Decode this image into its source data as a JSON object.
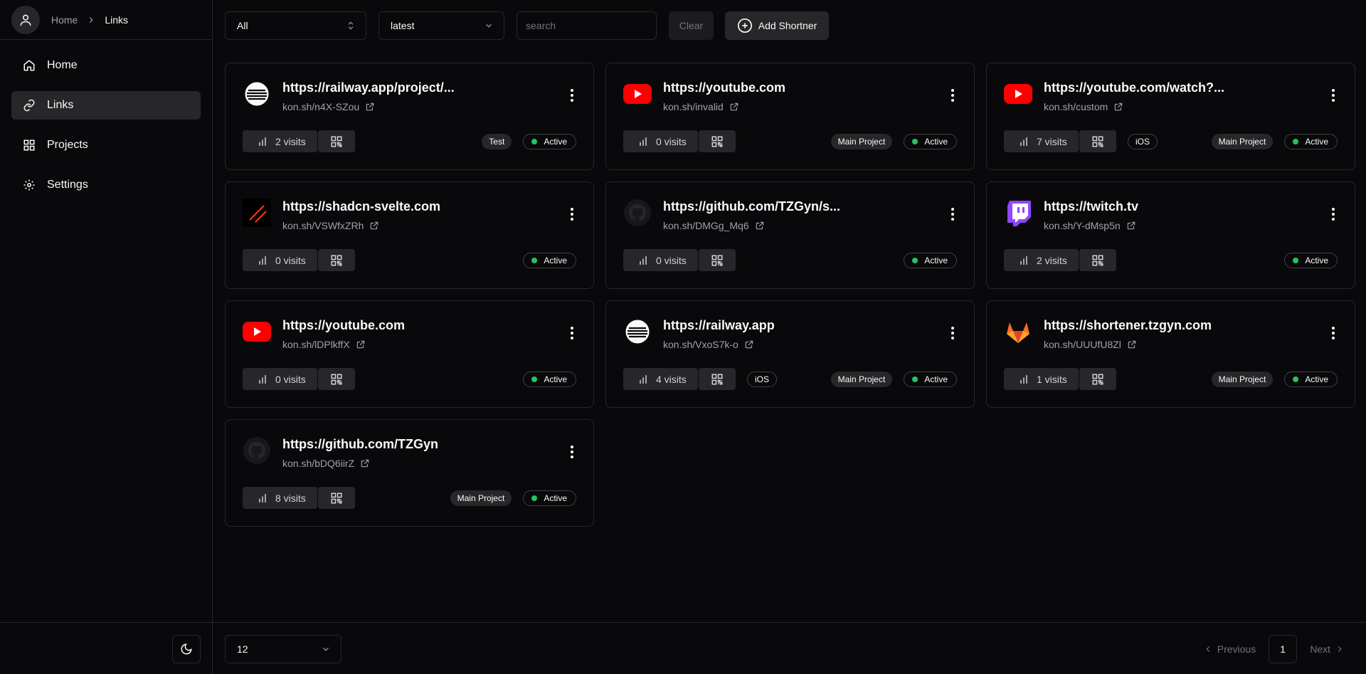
{
  "breadcrumb": {
    "home": "Home",
    "current": "Links"
  },
  "nav": [
    {
      "label": "Home",
      "icon": "home-icon"
    },
    {
      "label": "Links",
      "icon": "link-icon",
      "active": true
    },
    {
      "label": "Projects",
      "icon": "projects-icon"
    },
    {
      "label": "Settings",
      "icon": "settings-icon"
    }
  ],
  "toolbar": {
    "filter_value": "All",
    "sort_value": "latest",
    "search_placeholder": "search",
    "clear_label": "Clear",
    "add_label": "Add Shortner"
  },
  "links": [
    {
      "url": "https://railway.app/project/...",
      "short": "kon.sh/n4X-SZou",
      "visits": "2 visits",
      "favicon": "railway",
      "ios": false,
      "project": "Test",
      "status": "Active"
    },
    {
      "url": "https://youtube.com",
      "short": "kon.sh/invalid",
      "visits": "0 visits",
      "favicon": "youtube",
      "ios": false,
      "project": "Main Project",
      "status": "Active"
    },
    {
      "url": "https://youtube.com/watch?...",
      "short": "kon.sh/custom",
      "visits": "7 visits",
      "favicon": "youtube",
      "ios": true,
      "project": "Main Project",
      "status": "Active"
    },
    {
      "url": "https://shadcn-svelte.com",
      "short": "kon.sh/VSWfxZRh",
      "visits": "0 visits",
      "favicon": "shadcn",
      "ios": false,
      "project": "",
      "status": "Active"
    },
    {
      "url": "https://github.com/TZGyn/s...",
      "short": "kon.sh/DMGg_Mq6",
      "visits": "0 visits",
      "favicon": "github",
      "ios": false,
      "project": "",
      "status": "Active"
    },
    {
      "url": "https://twitch.tv",
      "short": "kon.sh/Y-dMsp5n",
      "visits": "2 visits",
      "favicon": "twitch",
      "ios": false,
      "project": "",
      "status": "Active"
    },
    {
      "url": "https://youtube.com",
      "short": "kon.sh/lDPlkffX",
      "visits": "0 visits",
      "favicon": "youtube",
      "ios": false,
      "project": "",
      "status": "Active"
    },
    {
      "url": "https://railway.app",
      "short": "kon.sh/VxoS7k-o",
      "visits": "4 visits",
      "favicon": "railway",
      "ios": true,
      "project": "Main Project",
      "status": "Active"
    },
    {
      "url": "https://shortener.tzgyn.com",
      "short": "kon.sh/UUUfU8Zl",
      "visits": "1 visits",
      "favicon": "gitlab",
      "ios": false,
      "project": "Main Project",
      "status": "Active"
    },
    {
      "url": "https://github.com/TZGyn",
      "short": "kon.sh/bDQ6iirZ",
      "visits": "8 visits",
      "favicon": "github",
      "ios": false,
      "project": "Main Project",
      "status": "Active"
    }
  ],
  "ios_label": "iOS",
  "footer": {
    "page_size": "12",
    "previous_label": "Previous",
    "current_page": "1",
    "next_label": "Next"
  },
  "colors": {
    "background": "#09090b",
    "border": "#27272a",
    "status_active": "#22c55e",
    "youtube": "#ff0000",
    "twitch": "#9146ff",
    "gitlab": "#fc6d26"
  }
}
